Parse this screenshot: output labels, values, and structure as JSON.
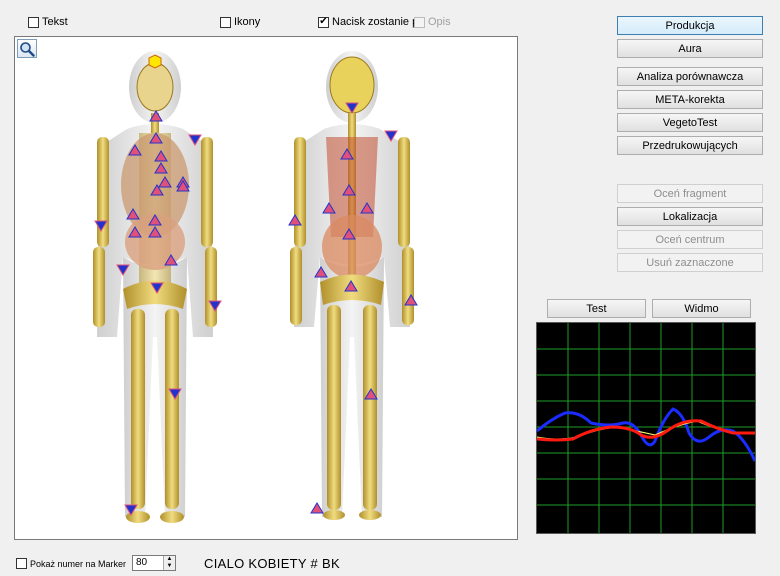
{
  "options": {
    "tekst": {
      "label": "Tekst",
      "checked": false
    },
    "ikony": {
      "label": "Ikony",
      "checked": false
    },
    "nacisk": {
      "label": "Nacisk zostanie p",
      "checked": true
    },
    "opis": {
      "label": "Opis",
      "checked": false,
      "disabled": true
    }
  },
  "buttons": {
    "produkcja": "Produkcja",
    "aura": "Aura",
    "analiza": "Analiza porównawcza",
    "meta": "META-korekta",
    "vegeto": "VegetoTest",
    "przedruk": "Przedrukowujących",
    "ocen_fragment": "Oceń fragment",
    "lokalizacja": "Lokalizacja",
    "ocen_centrum": "Oceń centrum",
    "usun": "Usuń zaznaczone",
    "test": "Test",
    "widmo": "Widmo"
  },
  "bottom": {
    "pokaz_label": "Pokaż numer na Marker",
    "pokaz_checked": false,
    "number_value": "80",
    "caption": "CIALO KOBIETY # BK"
  },
  "colors": {
    "marker_fill": "#e0507a",
    "marker_blue": "#2233cc",
    "skeleton": "#d8b848",
    "scope_grid": "#1e9e28",
    "trace_blue": "#1a2cff",
    "trace_red": "#ff1a10",
    "trace_yellow": "#ffff66"
  }
}
